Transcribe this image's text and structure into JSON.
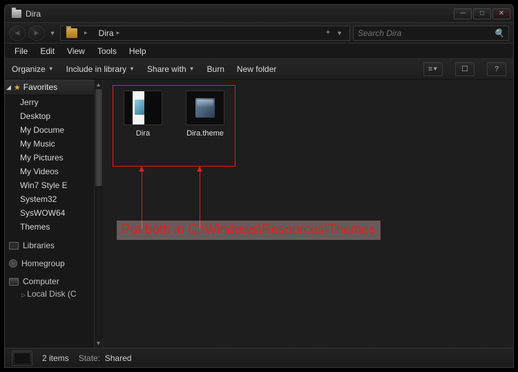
{
  "window": {
    "title": "Dira"
  },
  "wincontrols": {
    "min": "─",
    "max": "□",
    "close": "✕"
  },
  "nav": {
    "back": "◄",
    "forward": "►",
    "drop": "▼",
    "refresh": "↻"
  },
  "breadcrumb": {
    "seg": "Dira",
    "chev": "▸",
    "star": "✦"
  },
  "search": {
    "placeholder": "Search Dira"
  },
  "menu": {
    "items": [
      {
        "label": "File"
      },
      {
        "label": "Edit"
      },
      {
        "label": "View"
      },
      {
        "label": "Tools"
      },
      {
        "label": "Help"
      }
    ]
  },
  "toolbar": {
    "organize": "Organize",
    "include": "Include in library",
    "share": "Share with",
    "burn": "Burn",
    "newfolder": "New folder"
  },
  "sidebar": {
    "favorites": "Favorites",
    "items": [
      {
        "label": "Jerry"
      },
      {
        "label": "Desktop"
      },
      {
        "label": "My Docume"
      },
      {
        "label": "My Music"
      },
      {
        "label": "My Pictures"
      },
      {
        "label": "My Videos"
      },
      {
        "label": "Win7 Style E"
      },
      {
        "label": "System32"
      },
      {
        "label": "SysWOW64"
      },
      {
        "label": "Themes"
      }
    ],
    "libraries": "Libraries",
    "homegroup": "Homegroup",
    "computer": "Computer",
    "localdisk": "Local Disk (C"
  },
  "files": {
    "items": [
      {
        "name": "Dira"
      },
      {
        "name": "Dira.theme"
      }
    ]
  },
  "annotation": {
    "text": "Put both in C:\\Windows\\Resources\\Themes"
  },
  "status": {
    "count": "2 items",
    "state_label": "State:",
    "state_value": "Shared"
  }
}
